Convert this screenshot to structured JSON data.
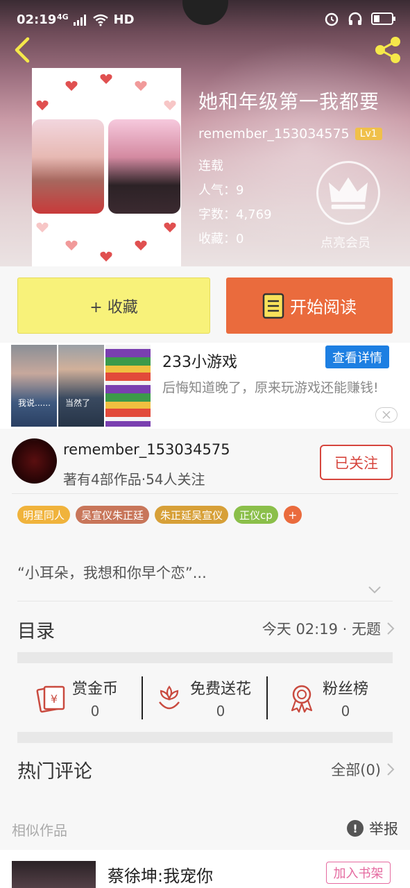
{
  "status_bar": {
    "time": "02:19",
    "network": "4G",
    "hd": "HD"
  },
  "book": {
    "title": "她和年级第一我都要",
    "author": "remember_153034575",
    "level": "Lv1",
    "status": "连载",
    "popularity": "人气：9",
    "word_count": "字数：4,769",
    "favorites": "收藏：0",
    "vip_label": "点亮会员"
  },
  "actions": {
    "collect_label": "+ 收藏",
    "read_label": "开始阅读"
  },
  "ad": {
    "title": "233小游戏",
    "button": "查看详情",
    "description": "后悔知道晚了，原来玩游戏还能赚钱!",
    "overlay_1": "我说......",
    "overlay_2": "当然了"
  },
  "author_card": {
    "name": "remember_153034575",
    "stats": "著有4部作品·54人关注",
    "follow_label": "已关注"
  },
  "tags": [
    {
      "label": "明星同人",
      "color": "#f0b33c"
    },
    {
      "label": "吴宣仪朱正廷",
      "color": "#c8765a"
    },
    {
      "label": "朱正延吴宣仪",
      "color": "#d7a038"
    },
    {
      "label": "正仪cp",
      "color": "#8bbf4a"
    }
  ],
  "tag_add": "+",
  "intro": "“小耳朵，我想和你早个恋”...",
  "toc": {
    "label": "目录",
    "latest": "今天 02:19 · 无题"
  },
  "stats": [
    {
      "label": "赏金币",
      "value": "0",
      "icon": "reward-coin-icon"
    },
    {
      "label": "免费送花",
      "value": "0",
      "icon": "flower-icon"
    },
    {
      "label": "粉丝榜",
      "value": "0",
      "icon": "medal-icon"
    }
  ],
  "comments": {
    "label": "热门评论",
    "all": "全部(0)"
  },
  "similar": {
    "label": "相似作品",
    "report": "举报"
  },
  "recommendation": {
    "title": "蔡徐坤:我宠你",
    "button": "加入书架"
  },
  "colors": {
    "accent_orange": "#ea6b3d",
    "collect_yellow": "#f8f27a",
    "follow_red": "#d6453d",
    "ad_blue": "#1d7fe2"
  }
}
